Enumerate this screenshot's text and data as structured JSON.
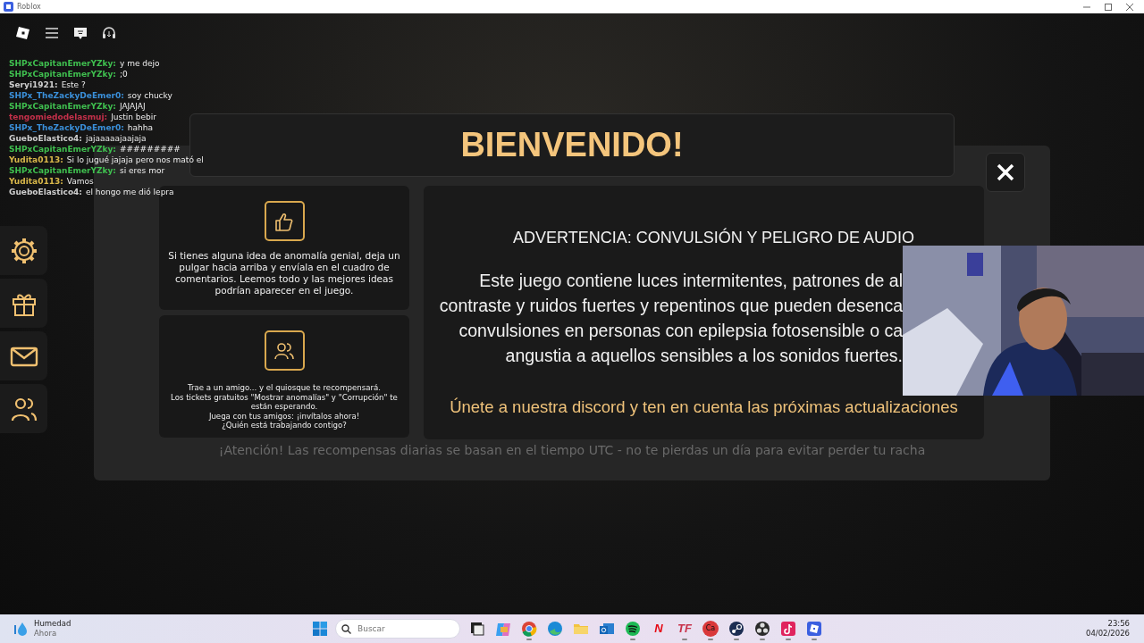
{
  "window": {
    "title": "Roblox"
  },
  "chat": [
    {
      "author": "SHPxCapitanEmerYZky:",
      "color": "#3fbf4f",
      "text": "y me dejo"
    },
    {
      "author": "SHPxCapitanEmerYZky:",
      "color": "#3fbf4f",
      "text": ";0"
    },
    {
      "author": "Seryi1921:",
      "color": "#cfcfcf",
      "text": "Este ?"
    },
    {
      "author": "SHPx_TheZackyDeEmer0:",
      "color": "#3a8fd9",
      "text": "soy chucky"
    },
    {
      "author": "SHPxCapitanEmerYZky:",
      "color": "#3fbf4f",
      "text": "JAJAJAJ"
    },
    {
      "author": "tengomiedodelasmuj:",
      "color": "#c4304a",
      "text": "Justin bebir"
    },
    {
      "author": "SHPx_TheZackyDeEmer0:",
      "color": "#3a8fd9",
      "text": "hahha"
    },
    {
      "author": "GueboElastico4:",
      "color": "#cfcfcf",
      "text": "jajaaaaajaajaja"
    },
    {
      "author": "SHPxCapitanEmerYZky:",
      "color": "#3fbf4f",
      "text": "#########"
    },
    {
      "author": "Yudita0113:",
      "color": "#d9b84a",
      "text": "Si lo jugué jajaja pero nos mató el"
    },
    {
      "author": "SHPxCapitanEmerYZky:",
      "color": "#3fbf4f",
      "text": "si eres mor"
    },
    {
      "author": "Yudita0113:",
      "color": "#d9b84a",
      "text": "Vamos"
    },
    {
      "author": "GueboElastico4:",
      "color": "#cfcfcf",
      "text": "el hongo me dió lepra"
    }
  ],
  "side_buttons": [
    {
      "kind": "gear"
    },
    {
      "kind": "gift"
    },
    {
      "kind": "mail"
    },
    {
      "kind": "people"
    }
  ],
  "background_notice": "¡Atención! Las recompensas diarias se basan en el tiempo UTC - no te pierdas un día para evitar perder tu racha",
  "modal": {
    "title": "BIENVENIDO!",
    "cards": [
      {
        "kind": "thumb",
        "lines": [
          "Si tienes alguna idea de anomalía genial, deja un pulgar hacia arriba y envíala en el cuadro de comentarios. Leemos todo y las mejores ideas podrían aparecer en el juego."
        ]
      },
      {
        "kind": "people",
        "lines": [
          "Trae a un amigo... y el quiosque te recompensará.",
          "Los tickets gratuitos \"Mostrar anomalías\" y \"Corrupción\" te están esperando.",
          "Juega con tus amigos: ¡invítalos ahora!",
          "¿Quién está trabajando contigo?"
        ]
      }
    ],
    "warning_title": "ADVERTENCIA: CONVULSIÓN Y PELIGRO DE AUDIO",
    "warning_lines": [
      "Este juego contiene luces intermitentes, patrones de al",
      "contraste y ruidos fuertes y repentinos que pueden desenca",
      "convulsiones en personas con epilepsia fotosensible o ca",
      "angustia a aquellos sensibles a los sonidos fuertes."
    ],
    "discord": "Únete a nuestra discord y ten en cuenta las próximas actualizaciones"
  },
  "taskbar": {
    "weather_title": "Humedad",
    "weather_sub": "Ahora",
    "search_placeholder": "Buscar",
    "apps": [
      {
        "kind": "taskview",
        "running": false
      },
      {
        "kind": "copilot",
        "running": false
      },
      {
        "kind": "chrome",
        "running": true
      },
      {
        "kind": "edge",
        "running": false
      },
      {
        "kind": "folder",
        "running": false
      },
      {
        "kind": "outlook",
        "running": false
      },
      {
        "kind": "spotify",
        "running": true
      },
      {
        "kind": "letter",
        "glyph": "N",
        "color": "#e50914",
        "running": false
      },
      {
        "kind": "letter",
        "glyph": "TF",
        "color": "#c8324a",
        "running": true
      },
      {
        "kind": "badge",
        "glyph": "Ca",
        "color": "#d9383a",
        "running": true
      },
      {
        "kind": "steam",
        "running": true
      },
      {
        "kind": "obs",
        "running": true
      },
      {
        "kind": "tiktok",
        "running": true
      },
      {
        "kind": "roblox",
        "running": true
      }
    ],
    "time": "23:56",
    "date": "04/02/2026"
  }
}
